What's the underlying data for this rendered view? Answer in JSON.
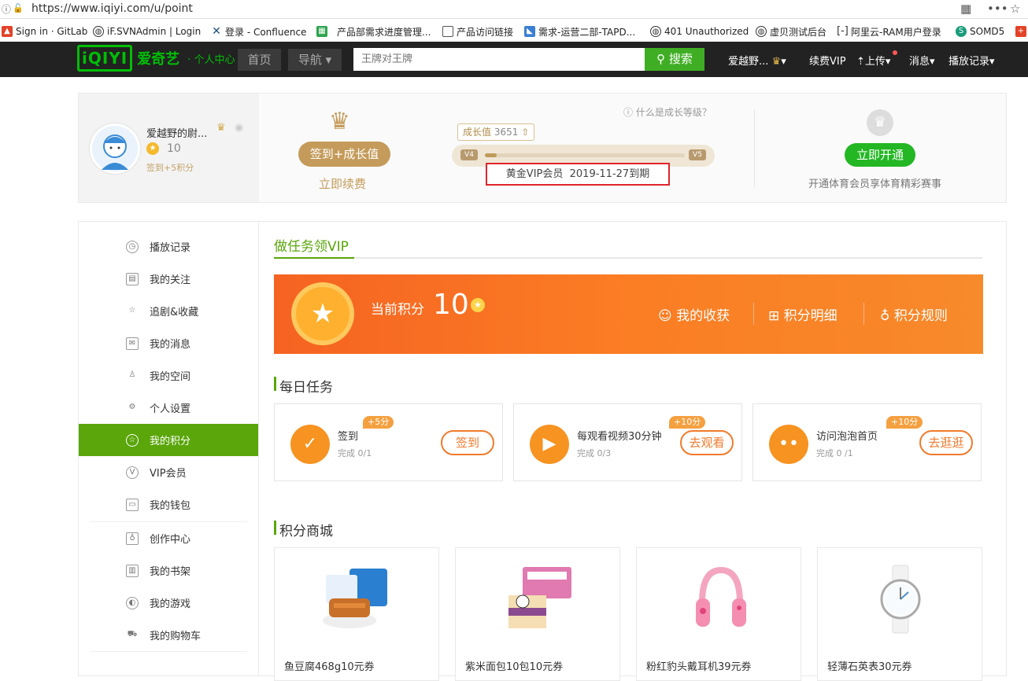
{
  "browser": {
    "url": "https://www.iqiyi.com/u/point"
  },
  "bookmarks": [
    "Sign in · GitLab",
    "iF.SVNAdmin | Login",
    "登录 - Confluence",
    "产品部需求进度管理...",
    "产品访问链接",
    "需求-运营二部-TAPD...",
    "401 Unauthorized",
    "虚贝测试后台",
    "阿里云-RAM用户登录",
    "SOMD5"
  ],
  "header": {
    "logo": "iQIYI",
    "logo_name": "爱奇艺",
    "logo_sub": "· 个人中心",
    "home": "首页",
    "nav": "导航",
    "search_placeholder": "王牌对王牌",
    "search_btn": "搜索",
    "user": "爱越野...",
    "renew": "续费VIP",
    "upload": "上传",
    "messages": "消息",
    "history": "播放记录"
  },
  "profile": {
    "name": "爱越野的尉...",
    "points": "10",
    "sign_hint": "签到+5积分",
    "sign_btn": "签到+成长值",
    "renew_link": "立即续费",
    "growth_help": "什么是成长等级？",
    "growth_label": "成长值",
    "growth_value": "3651",
    "level_from": "V4",
    "level_to": "V5",
    "growth_progress": 0.03,
    "vip_info": "黄金VIP会员",
    "vip_expire": "2019-11-27到期",
    "sports_btn": "立即开通",
    "sports_desc": "开通体育会员享体育精彩赛事"
  },
  "sidebar": {
    "items": [
      "播放记录",
      "我的关注",
      "追剧&收藏",
      "我的消息",
      "我的空间",
      "个人设置",
      "我的积分",
      "VIP会员",
      "我的钱包",
      "创作中心",
      "我的书架",
      "我的游戏",
      "我的购物车"
    ],
    "active_index": 6
  },
  "main": {
    "tab": "做任务领VIP",
    "banner": {
      "label": "当前积分",
      "points": "10",
      "links": [
        "我的收获",
        "积分明细",
        "积分规则"
      ]
    },
    "daily_title": "每日任务",
    "tasks": [
      {
        "name": "签到",
        "progress": "完成 0/1",
        "badge": "+5分",
        "btn": "签到"
      },
      {
        "name": "每观看视频30分钟",
        "progress": "完成 0/3",
        "badge": "+10分",
        "btn": "去观看"
      },
      {
        "name": "访问泡泡首页",
        "progress": "完成 0 /1",
        "badge": "+10分",
        "btn": "去逛逛"
      }
    ],
    "shop_title": "积分商城",
    "products": [
      "鱼豆腐468g10元券",
      "紫米面包10包10元券",
      "粉红豹头戴耳机39元券",
      "轻薄石英表30元券"
    ]
  }
}
